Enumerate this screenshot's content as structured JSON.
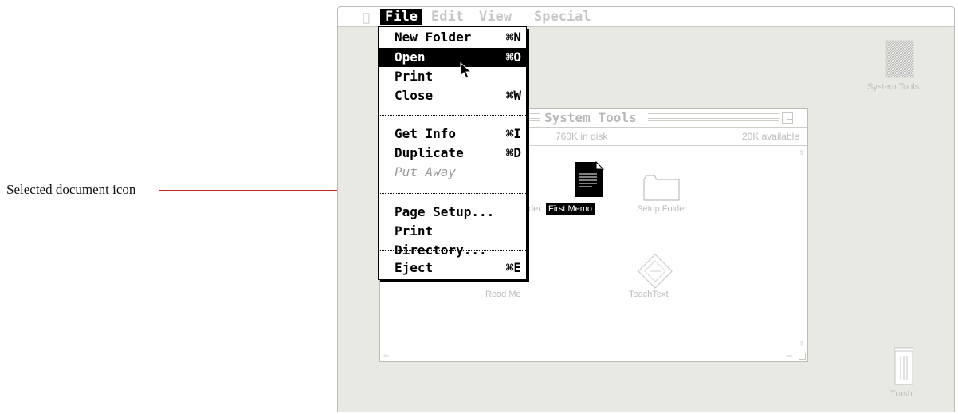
{
  "callout": {
    "label": "Selected document icon"
  },
  "menubar": {
    "items": [
      {
        "label": "File"
      },
      {
        "label": "Edit"
      },
      {
        "label": "View"
      },
      {
        "label": "Special"
      }
    ]
  },
  "file_menu": {
    "items": [
      {
        "label": "New Folder",
        "shortcut": "⌘N"
      },
      {
        "label": "Open",
        "shortcut": "⌘O"
      },
      {
        "label": "Print",
        "shortcut": ""
      },
      {
        "label": "Close",
        "shortcut": "⌘W"
      },
      {
        "label": "Get Info",
        "shortcut": "⌘I"
      },
      {
        "label": "Duplicate",
        "shortcut": "⌘D"
      },
      {
        "label": "Put Away",
        "shortcut": ""
      },
      {
        "label": "Page Setup...",
        "shortcut": ""
      },
      {
        "label": "Print Directory...",
        "shortcut": ""
      },
      {
        "label": "Eject",
        "shortcut": "⌘E"
      }
    ]
  },
  "window": {
    "title": "System Tools",
    "disk_info": "760K in disk",
    "available": "20K available",
    "icons": [
      {
        "label": "der"
      },
      {
        "label": "First Memo"
      },
      {
        "label": "Setup Folder"
      },
      {
        "label": "Read Me"
      },
      {
        "label": "TeachText"
      }
    ]
  },
  "desktop": {
    "disk_label": "System Tools",
    "trash_label": "Trash"
  }
}
